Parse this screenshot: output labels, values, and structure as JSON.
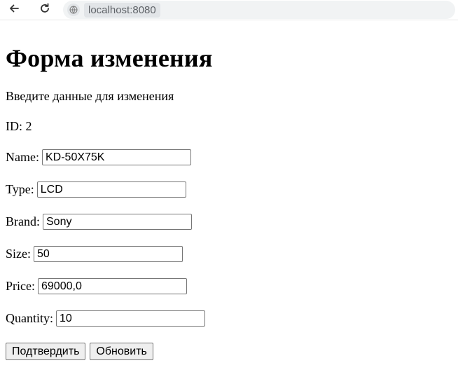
{
  "browser": {
    "url": "localhost:8080",
    "back_icon": "arrow-left-icon",
    "reload_icon": "reload-icon",
    "site_icon": "globe-icon"
  },
  "page": {
    "title": "Форма изменения",
    "subtitle": "Введите данные для изменения",
    "id_label": "ID: 2"
  },
  "form": {
    "fields": [
      {
        "label": "Name:",
        "value": "KD-50X75K"
      },
      {
        "label": "Type:",
        "value": "LCD"
      },
      {
        "label": "Brand:",
        "value": "Sony"
      },
      {
        "label": "Size:",
        "value": "50"
      },
      {
        "label": "Price:",
        "value": "69000,0"
      },
      {
        "label": "Quantity:",
        "value": "10"
      }
    ],
    "submit_label": "Подтвердить",
    "update_label": "Обновить"
  }
}
